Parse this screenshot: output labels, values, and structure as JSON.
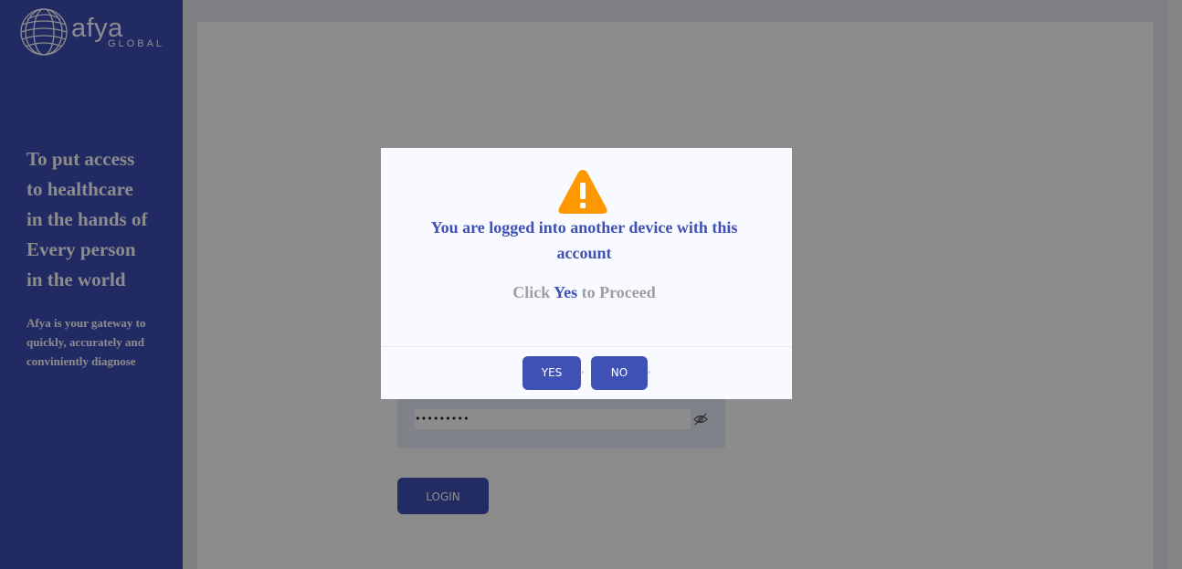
{
  "brand": {
    "name": "afya",
    "sub": "GLOBAL",
    "tagline_lines": [
      "To put access",
      "to healthcare",
      "in the hands of",
      "Every person",
      "in the world"
    ],
    "description": "Afya is your gateway to quickly, accurately and conviniently diagnose"
  },
  "login_form": {
    "password_value": "•••••••••",
    "login_label": "LOGIN"
  },
  "modal": {
    "title": "You are logged into another device with this account",
    "msg_prefix": "Click ",
    "msg_highlight": "Yes",
    "msg_suffix": " to Proceed",
    "yes_label": "YES",
    "no_label": "NO",
    "separator": ","
  },
  "colors": {
    "brand_blue": "#3f51b5",
    "warning_orange": "#ff9800",
    "muted_text": "#9e9e9e"
  },
  "icons": {
    "logo": "globe-icon",
    "password_toggle": "eye-slash-icon",
    "modal_warning": "warning-triangle-icon"
  }
}
